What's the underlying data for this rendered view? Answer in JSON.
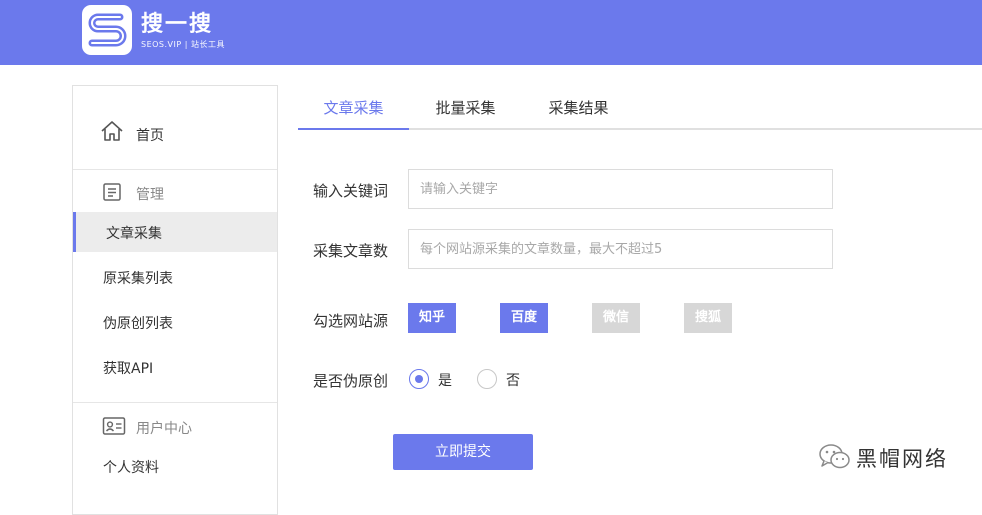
{
  "header": {
    "brand_name": "搜一搜",
    "brand_sub": "SEOS.VIP | 站长工具",
    "logo_letter": "S",
    "background": "#6b79ec"
  },
  "sidebar": {
    "home": {
      "label": "首页",
      "icon": "home-icon"
    },
    "groups": [
      {
        "label": "管理",
        "icon": "document-list-icon",
        "items": [
          {
            "label": "文章采集",
            "active": true
          },
          {
            "label": "原采集列表",
            "active": false
          },
          {
            "label": "伪原创列表",
            "active": false
          },
          {
            "label": "获取API",
            "active": false
          }
        ]
      },
      {
        "label": "用户中心",
        "icon": "id-card-icon",
        "items": [
          {
            "label": "个人资料",
            "active": false
          }
        ]
      }
    ]
  },
  "tabs": [
    {
      "label": "文章采集",
      "active": true
    },
    {
      "label": "批量采集",
      "active": false
    },
    {
      "label": "采集结果",
      "active": false
    }
  ],
  "form": {
    "keyword": {
      "label": "输入关键词",
      "placeholder": "请输入关键字",
      "value": ""
    },
    "count": {
      "label": "采集文章数",
      "placeholder": "每个网站源采集的文章数量，最大不超过5",
      "value": ""
    },
    "sources": {
      "label": "勾选网站源",
      "options": [
        {
          "label": "知乎",
          "selected": true
        },
        {
          "label": "百度",
          "selected": true
        },
        {
          "label": "微信",
          "selected": false
        },
        {
          "label": "搜狐",
          "selected": false
        }
      ]
    },
    "rewrite": {
      "label": "是否伪原创",
      "options": [
        {
          "label": "是",
          "checked": true
        },
        {
          "label": "否",
          "checked": false
        }
      ]
    },
    "submit_label": "立即提交"
  },
  "watermark": {
    "text": "黑帽网络",
    "icon": "wechat-icon"
  },
  "colors": {
    "accent": "#6b79ec",
    "disabled": "#d7d7d7",
    "active_bg": "#ececec"
  }
}
